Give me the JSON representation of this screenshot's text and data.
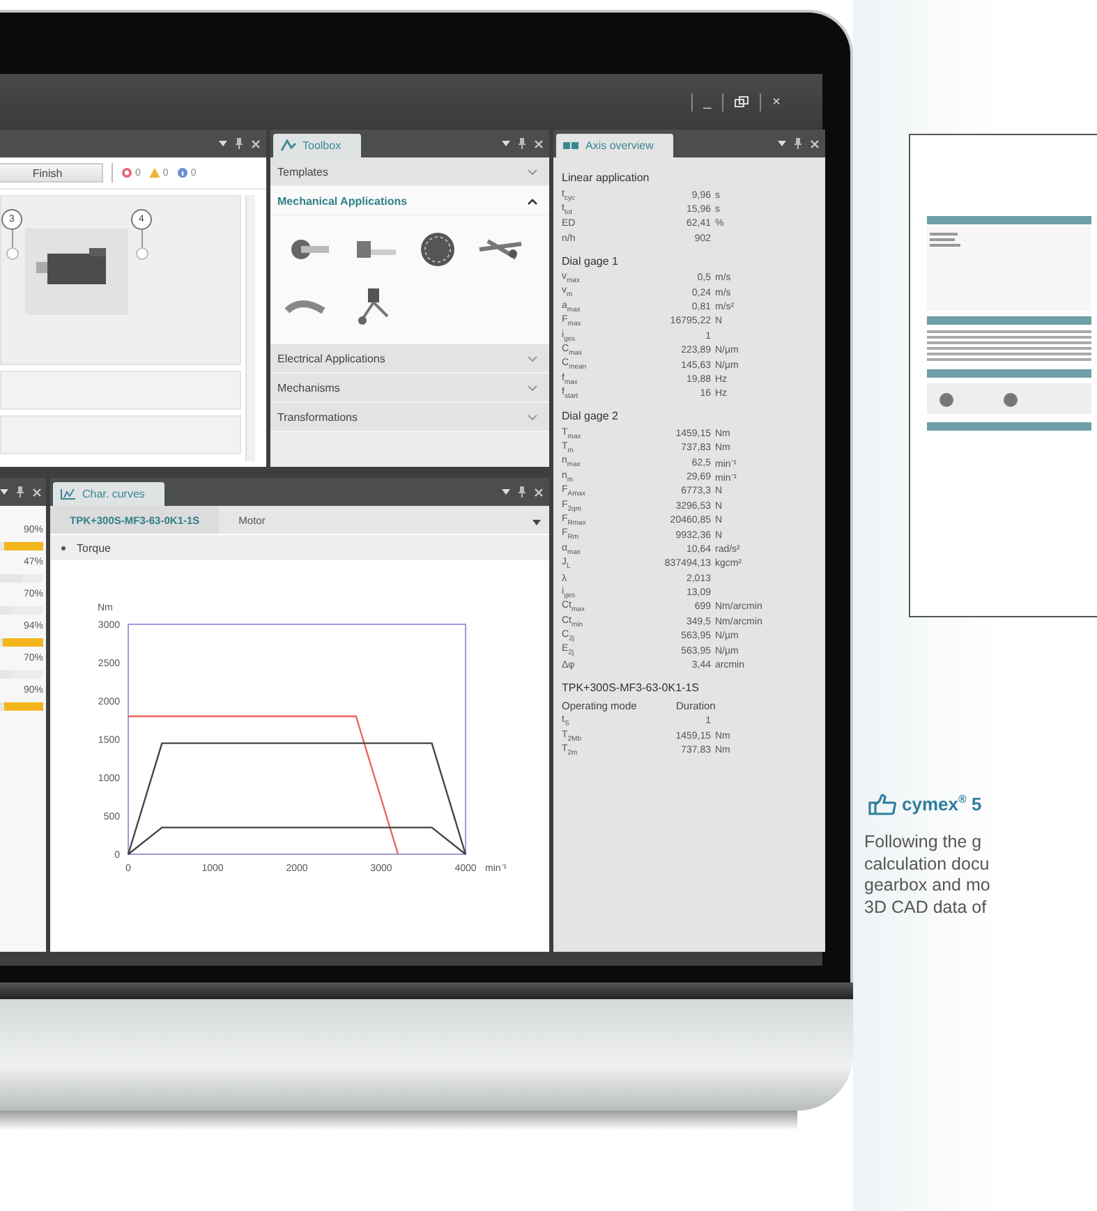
{
  "window": {
    "minimize": "_",
    "close": "×"
  },
  "process_panel": {
    "finish_button": "Finish",
    "counters": [
      {
        "kind": "error",
        "count": "0"
      },
      {
        "kind": "warning",
        "count": "0"
      },
      {
        "kind": "info",
        "count": "0"
      }
    ],
    "nodes": [
      "3",
      "4"
    ]
  },
  "toolbox": {
    "title": "Toolbox",
    "sections": [
      {
        "label": "Templates",
        "expanded": false
      },
      {
        "label": "Mechanical Applications",
        "expanded": true
      },
      {
        "label": "Electrical Applications",
        "expanded": false
      },
      {
        "label": "Mechanisms",
        "expanded": false
      },
      {
        "label": "Transformations",
        "expanded": false
      }
    ]
  },
  "utilization": [
    {
      "reading": "90%",
      "level": 0.9
    },
    {
      "reading": "47%",
      "level": 0.47
    },
    {
      "reading": "70%",
      "level": 0.7
    },
    {
      "reading": "94%",
      "level": 0.94
    },
    {
      "reading": "70%",
      "level": 0.7
    },
    {
      "reading": "90%",
      "level": 0.9
    }
  ],
  "char_curves": {
    "title": "Char. curves",
    "tabs": [
      {
        "label": "TPK+300S-MF3-63-0K1-1S",
        "selected": true
      },
      {
        "label": "Motor",
        "selected": false
      }
    ],
    "section": "Torque",
    "chart_data": {
      "type": "line",
      "xlabel": "min⁻¹",
      "ylabel": "Nm",
      "x": [
        0,
        400,
        2700,
        3200,
        3600,
        4000
      ],
      "series": [
        {
          "color": "#e8665a",
          "values": [
            1800,
            1800,
            1800,
            0,
            null,
            null
          ]
        },
        {
          "color": "#444444",
          "values": [
            0,
            1450,
            1450,
            1450,
            1450,
            0
          ]
        },
        {
          "color": "#444444",
          "values": [
            0,
            350,
            350,
            350,
            350,
            0
          ]
        }
      ],
      "xlim": [
        0,
        4000
      ],
      "ylim": [
        0,
        3000
      ],
      "xticks": [
        0,
        1000,
        2000,
        3000,
        4000
      ],
      "yticks": [
        0,
        500,
        1000,
        1500,
        2000,
        2500,
        3000
      ]
    }
  },
  "axis_overview": {
    "title": "Axis overview",
    "groups": [
      {
        "heading": "Linear application",
        "rows": [
          {
            "kind": "value",
            "label": "t$_{cyc}$",
            "value": "9,96",
            "unit": "s"
          },
          {
            "kind": "value",
            "label": "t$_{tot}$",
            "value": "15,96",
            "unit": "s"
          },
          {
            "kind": "value",
            "label": "ED",
            "value": "62,41",
            "unit": "%"
          },
          {
            "kind": "value",
            "label": "n/h",
            "value": "902"
          }
        ]
      },
      {
        "heading": "Dial gage 1",
        "rows": [
          {
            "kind": "value",
            "label": "v$_{max}$",
            "value": "0,5",
            "unit": "m/s"
          },
          {
            "kind": "value",
            "label": "v$_{m}$",
            "value": "0,24",
            "unit": "m/s"
          },
          {
            "kind": "value",
            "label": "a$_{max}$",
            "value": "0,81",
            "unit": "m/s²"
          },
          {
            "kind": "value",
            "label": "F$_{max}$",
            "value": "16795,22",
            "unit": "N"
          },
          {
            "kind": "value",
            "label": "i$_{ges}$",
            "value": "1"
          },
          {
            "kind": "value",
            "label": "C$_{max}$",
            "value": "223,89",
            "unit": "N/µm"
          },
          {
            "kind": "value",
            "label": "C$_{mean}$",
            "value": "145,63",
            "unit": "N/µm"
          },
          {
            "kind": "value",
            "label": "f$_{max}$",
            "value": "19,88",
            "unit": "Hz"
          },
          {
            "kind": "value",
            "label": "f$_{start}$",
            "value": "16",
            "unit": "Hz"
          }
        ]
      },
      {
        "heading": "Dial gage 2",
        "rows": [
          {
            "kind": "value",
            "label": "T$_{max}$",
            "value": "1459,15",
            "unit": "Nm"
          },
          {
            "kind": "value",
            "label": "T$_{m}$",
            "value": "737,83",
            "unit": "Nm"
          },
          {
            "kind": "value",
            "label": "n$_{max}$",
            "value": "62,5",
            "unit": "min⁻¹"
          },
          {
            "kind": "value",
            "label": "n$_{m}$",
            "value": "29,69",
            "unit": "min⁻¹"
          },
          {
            "kind": "value",
            "label": "F$_{Amax}$",
            "value": "6773,3",
            "unit": "N"
          },
          {
            "kind": "value",
            "label": "F$_{2qm}$",
            "value": "3296,53",
            "unit": "N"
          },
          {
            "kind": "value",
            "label": "F$_{Rmax}$",
            "value": "20460,85",
            "unit": "N"
          },
          {
            "kind": "value",
            "label": "F$_{Rm}$",
            "value": "9932,36",
            "unit": "N"
          },
          {
            "kind": "value",
            "label": "α$_{max}$",
            "value": "10,64",
            "unit": "rad/s²"
          },
          {
            "kind": "value",
            "label": "J$_{L}$",
            "value": "837494,13",
            "unit": "kgcm²"
          },
          {
            "kind": "value",
            "label": "λ",
            "value": "2,013"
          },
          {
            "kind": "value",
            "label": "i$_{ges}$",
            "value": "13,09"
          },
          {
            "kind": "value",
            "label": "Ct$_{max}$",
            "value": "699",
            "unit": "Nm/arcmin"
          },
          {
            "kind": "value",
            "label": "Ct$_{min}$",
            "value": "349,5",
            "unit": "Nm/arcmin"
          },
          {
            "kind": "value",
            "label": "C$_{2j}$",
            "value": "563,95",
            "unit": "N/µm"
          },
          {
            "kind": "value",
            "label": "E$_{2j}$",
            "value": "563,95",
            "unit": "N/µm"
          },
          {
            "kind": "value",
            "label": "Δφ",
            "value": "3,44",
            "unit": "arcmin"
          }
        ]
      },
      {
        "heading": "TPK+300S-MF3-63-0K1-1S",
        "rows": [
          {
            "kind": "header",
            "label": "Operating mode",
            "value": "Duration"
          },
          {
            "kind": "value",
            "label": "t$_{S}$",
            "value": "1"
          },
          {
            "kind": "value",
            "label": "T$_{2Mb}$",
            "value": "1459,15",
            "unit": "Nm"
          },
          {
            "kind": "value",
            "label": "T$_{2m}$",
            "value": "737,83",
            "unit": "Nm"
          }
        ]
      }
    ]
  },
  "brochure": {
    "heading": "cymex$^{®}$ 5",
    "text": "Following the g\ncalculation docu\ngearbox and mo\n3D CAD data of"
  }
}
